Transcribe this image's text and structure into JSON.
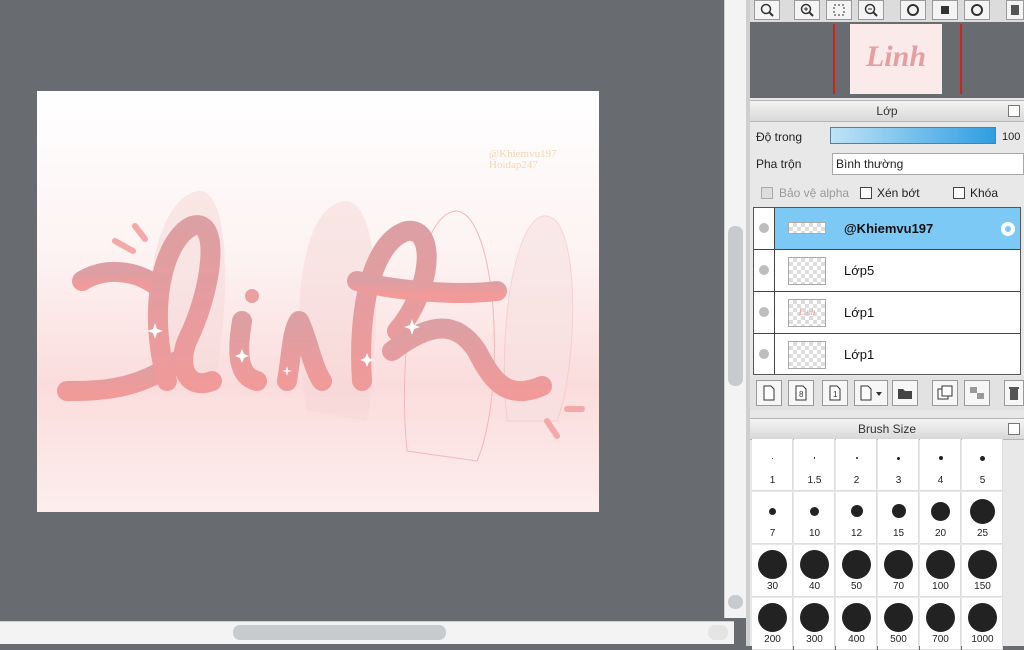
{
  "canvas": {
    "watermark_line1": "@Khiemvu197",
    "watermark_line2": "Hoidap247",
    "art_text": "Linh"
  },
  "navigator": {
    "buttons": [
      "zoom-fit-icon",
      "zoom-in-icon",
      "fit-window-icon",
      "zoom-out-icon",
      "rotate-left-icon",
      "fullscreen-icon",
      "rotate-right-icon",
      "flip-icon"
    ],
    "thumb_text": "Linh"
  },
  "layers_panel": {
    "title": "Lớp",
    "opacity_label": "Độ trong",
    "opacity_value": "100",
    "opacity_level": 1.0,
    "blend_label": "Pha trộn",
    "blend_value": "Bình thường",
    "protect_alpha_label": "Bảo vệ alpha",
    "clip_label": "Xén bớt",
    "lock_label": "Khóa",
    "layers": [
      {
        "name": "@Khiemvu197",
        "selected": true
      },
      {
        "name": "Lớp5",
        "selected": false
      },
      {
        "name": "Lớp1",
        "selected": false
      },
      {
        "name": "Lớp1",
        "selected": false
      }
    ],
    "toolbar": [
      "new-layer-icon",
      "new-8bit-layer-icon",
      "new-1bit-layer-icon",
      "new-layer-menu-icon",
      "new-folder-icon",
      "copy-layer-icon",
      "merge-layer-icon",
      "delete-layer-icon"
    ]
  },
  "brush_size_panel": {
    "title": "Brush Size",
    "sizes": [
      "1",
      "1.5",
      "2",
      "3",
      "4",
      "5",
      "7",
      "10",
      "12",
      "15",
      "20",
      "25",
      "30",
      "40",
      "50",
      "70",
      "100",
      "150",
      "200",
      "300",
      "400",
      "500",
      "700",
      "1000"
    ]
  },
  "colors": {
    "canvas_bg": "#686b70",
    "selected_layer": "#7dc9f6",
    "opacity_bar": "#2f9de0",
    "letter_pink": "#e9a0a0"
  }
}
